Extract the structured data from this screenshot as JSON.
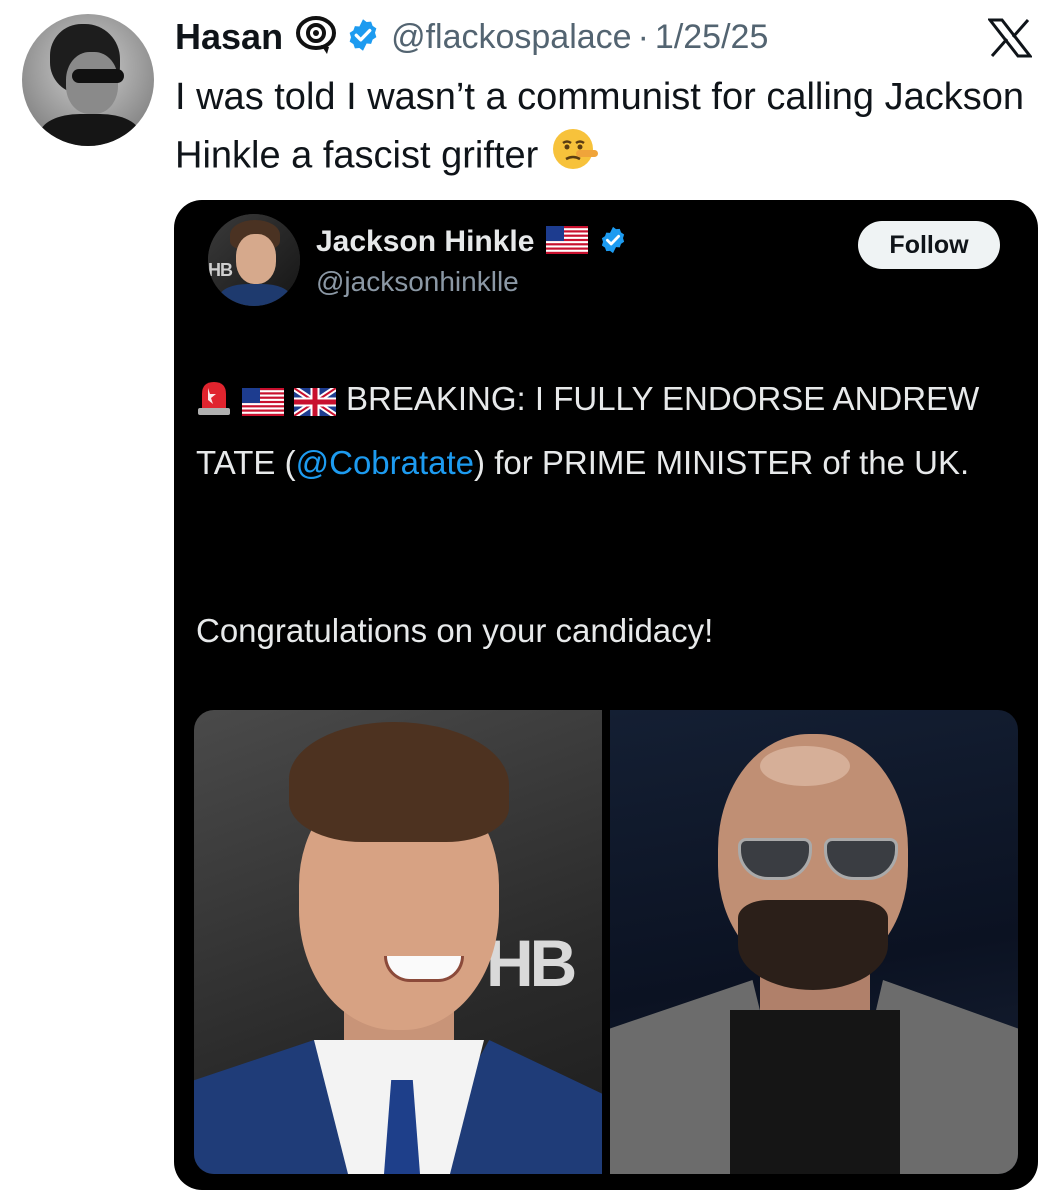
{
  "tweet": {
    "author": {
      "display_name": "Hasan",
      "handle": "@flackospalace",
      "badge_icon": "eye-target-badge-icon",
      "verified_icon": "verified-badge-icon",
      "verified_color": "#1d9bf0"
    },
    "separator": "·",
    "date": "1/25/25",
    "text": "I was told I wasn’t a communist for calling Jackson Hinkle a fascist grifter",
    "emoji_icon": "lying-face-emoji-icon",
    "platform_logo": "x-logo-icon"
  },
  "quoted_tweet": {
    "author": {
      "display_name": "Jackson Hinkle",
      "handle": "@jacksonhinklle",
      "flag_icon": "us-flag-icon",
      "verified_icon": "verified-badge-icon",
      "avatar_overlay_text": "HB"
    },
    "follow_label": "Follow",
    "body": {
      "icons": [
        "siren-emoji-icon",
        "us-flag-icon",
        "uk-flag-icon"
      ],
      "text_before_mention": "BREAKING: I FULLY ENDORSE ANDREW TATE (",
      "mention": "@Cobratate",
      "text_after_mention": ") for PRIME MINISTER of the UK.",
      "congrats": "Congratulations on your candidacy!"
    },
    "media": {
      "left_photo_overlay_text": "HB",
      "left_photo": "photo-man-smiling-blue-suit",
      "right_photo": "photo-bald-man-sunglasses-gray-jacket"
    },
    "colors": {
      "background": "#000000",
      "text": "#e7e9ea",
      "muted": "#8b98a5",
      "link": "#1d9bf0"
    }
  }
}
